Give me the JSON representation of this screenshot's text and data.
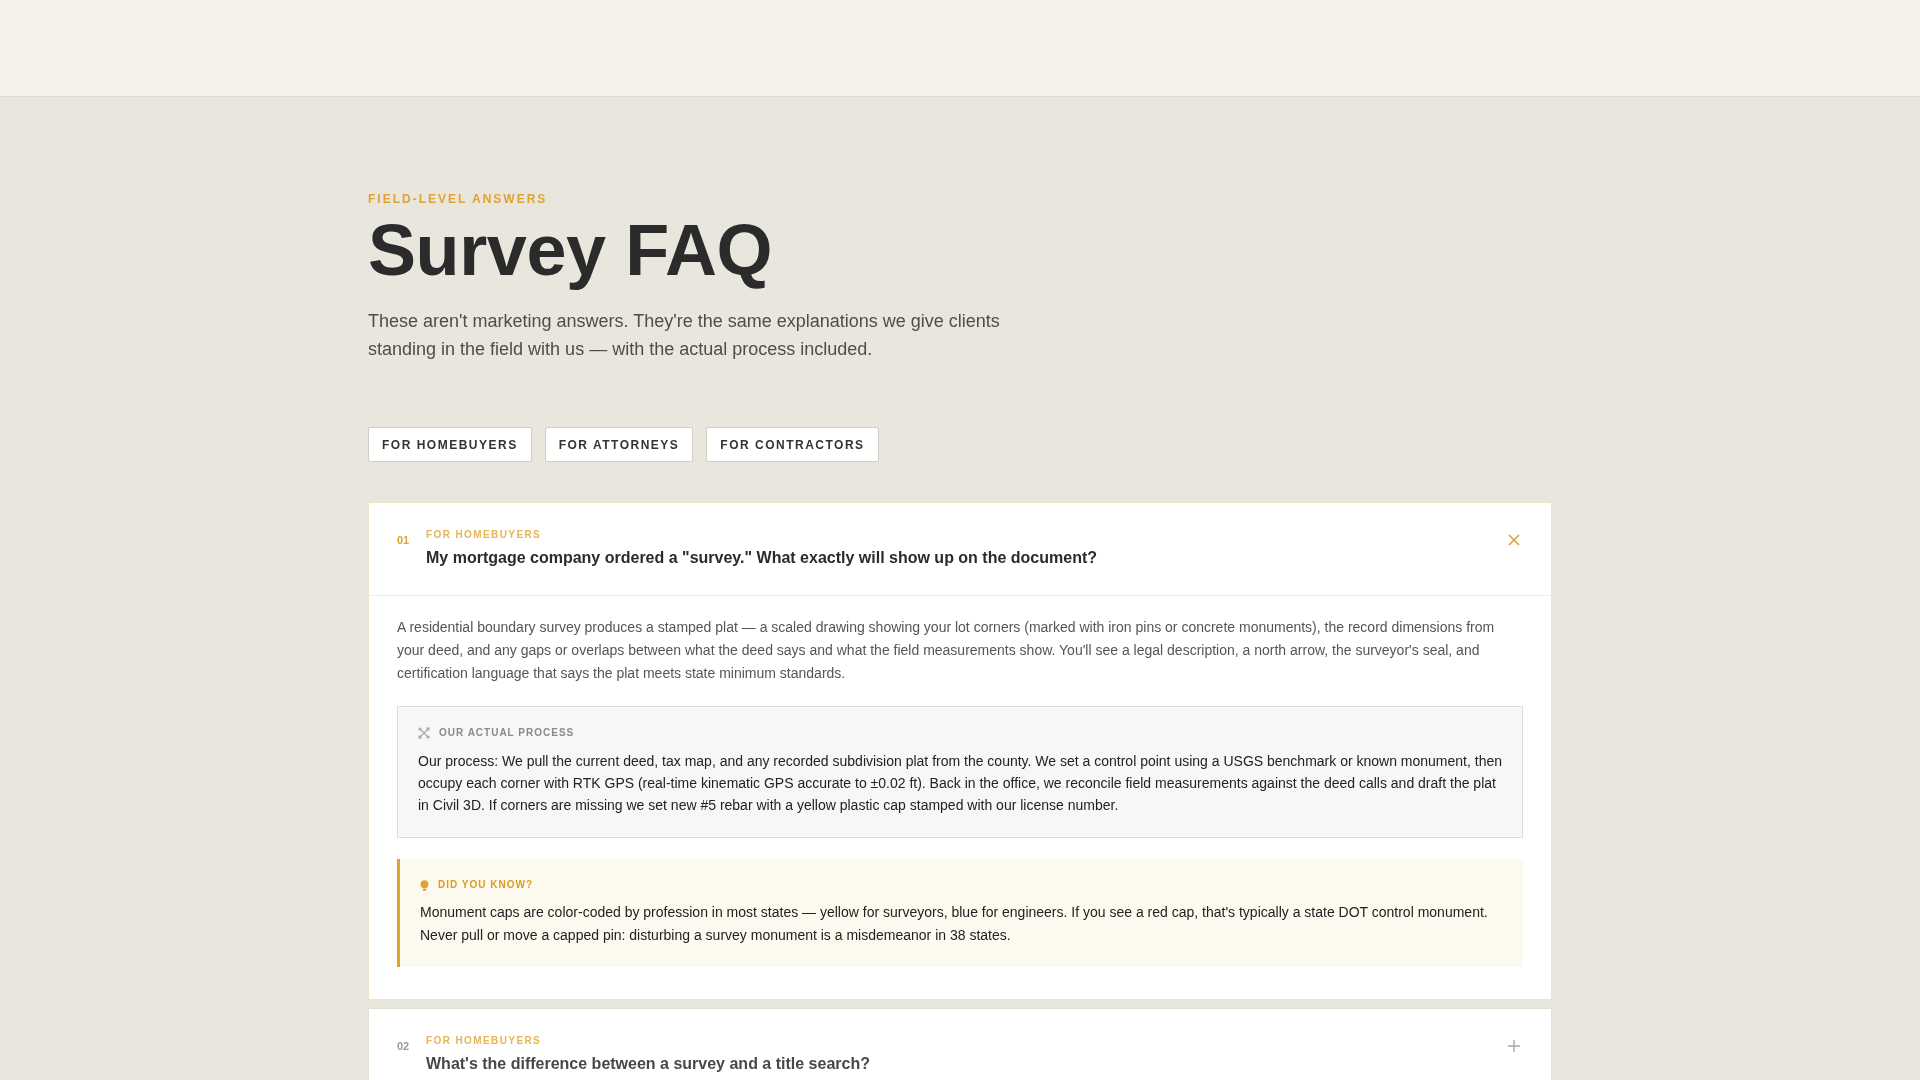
{
  "hero": {
    "eyebrow": "FIELD-LEVEL ANSWERS",
    "title": "Survey FAQ",
    "intro": "These aren't marketing answers. They're the same explanations we give clients standing in the field with us — with the actual process included."
  },
  "filters": [
    {
      "label": "FOR HOMEBUYERS",
      "selected": false
    },
    {
      "label": "FOR ATTORNEYS",
      "selected": false
    },
    {
      "label": "FOR CONTRACTORS",
      "selected": false
    }
  ],
  "faq": [
    {
      "number": "01",
      "category": "FOR HOMEBUYERS",
      "question": "My mortgage company ordered a \"survey.\" What exactly will show up on the document?",
      "expanded": true,
      "answer": "A residential boundary survey produces a stamped plat — a scaled drawing showing your lot corners (marked with iron pins or concrete monuments), the record dimensions from your deed, and any gaps or overlaps between what the deed says and what the field measurements show. You'll see a legal description, a north arrow, the surveyor's seal, and certification language that says the plat meets state minimum standards.",
      "process": {
        "label": "OUR ACTUAL PROCESS",
        "text": "Our process: We pull the current deed, tax map, and any recorded subdivision plat from the county. We set a control point using a USGS benchmark or known monument, then occupy each corner with RTK GPS (real-time kinematic GPS accurate to ±0.02 ft). Back in the office, we reconcile field measurements against the deed calls and draft the plat in Civil 3D. If corners are missing we set new #5 rebar with a yellow plastic cap stamped with our license number."
      },
      "tip": {
        "label": "DID YOU KNOW?",
        "text": "Monument caps are color-coded by profession in most states — yellow for surveyors, blue for engineers. If you see a red cap, that's typically a state DOT control monument. Never pull or move a capped pin: disturbing a survey monument is a misdemeanor in 38 states."
      }
    },
    {
      "number": "02",
      "category": "FOR HOMEBUYERS",
      "question": "What's the difference between a survey and a title search?",
      "expanded": false
    }
  ]
}
